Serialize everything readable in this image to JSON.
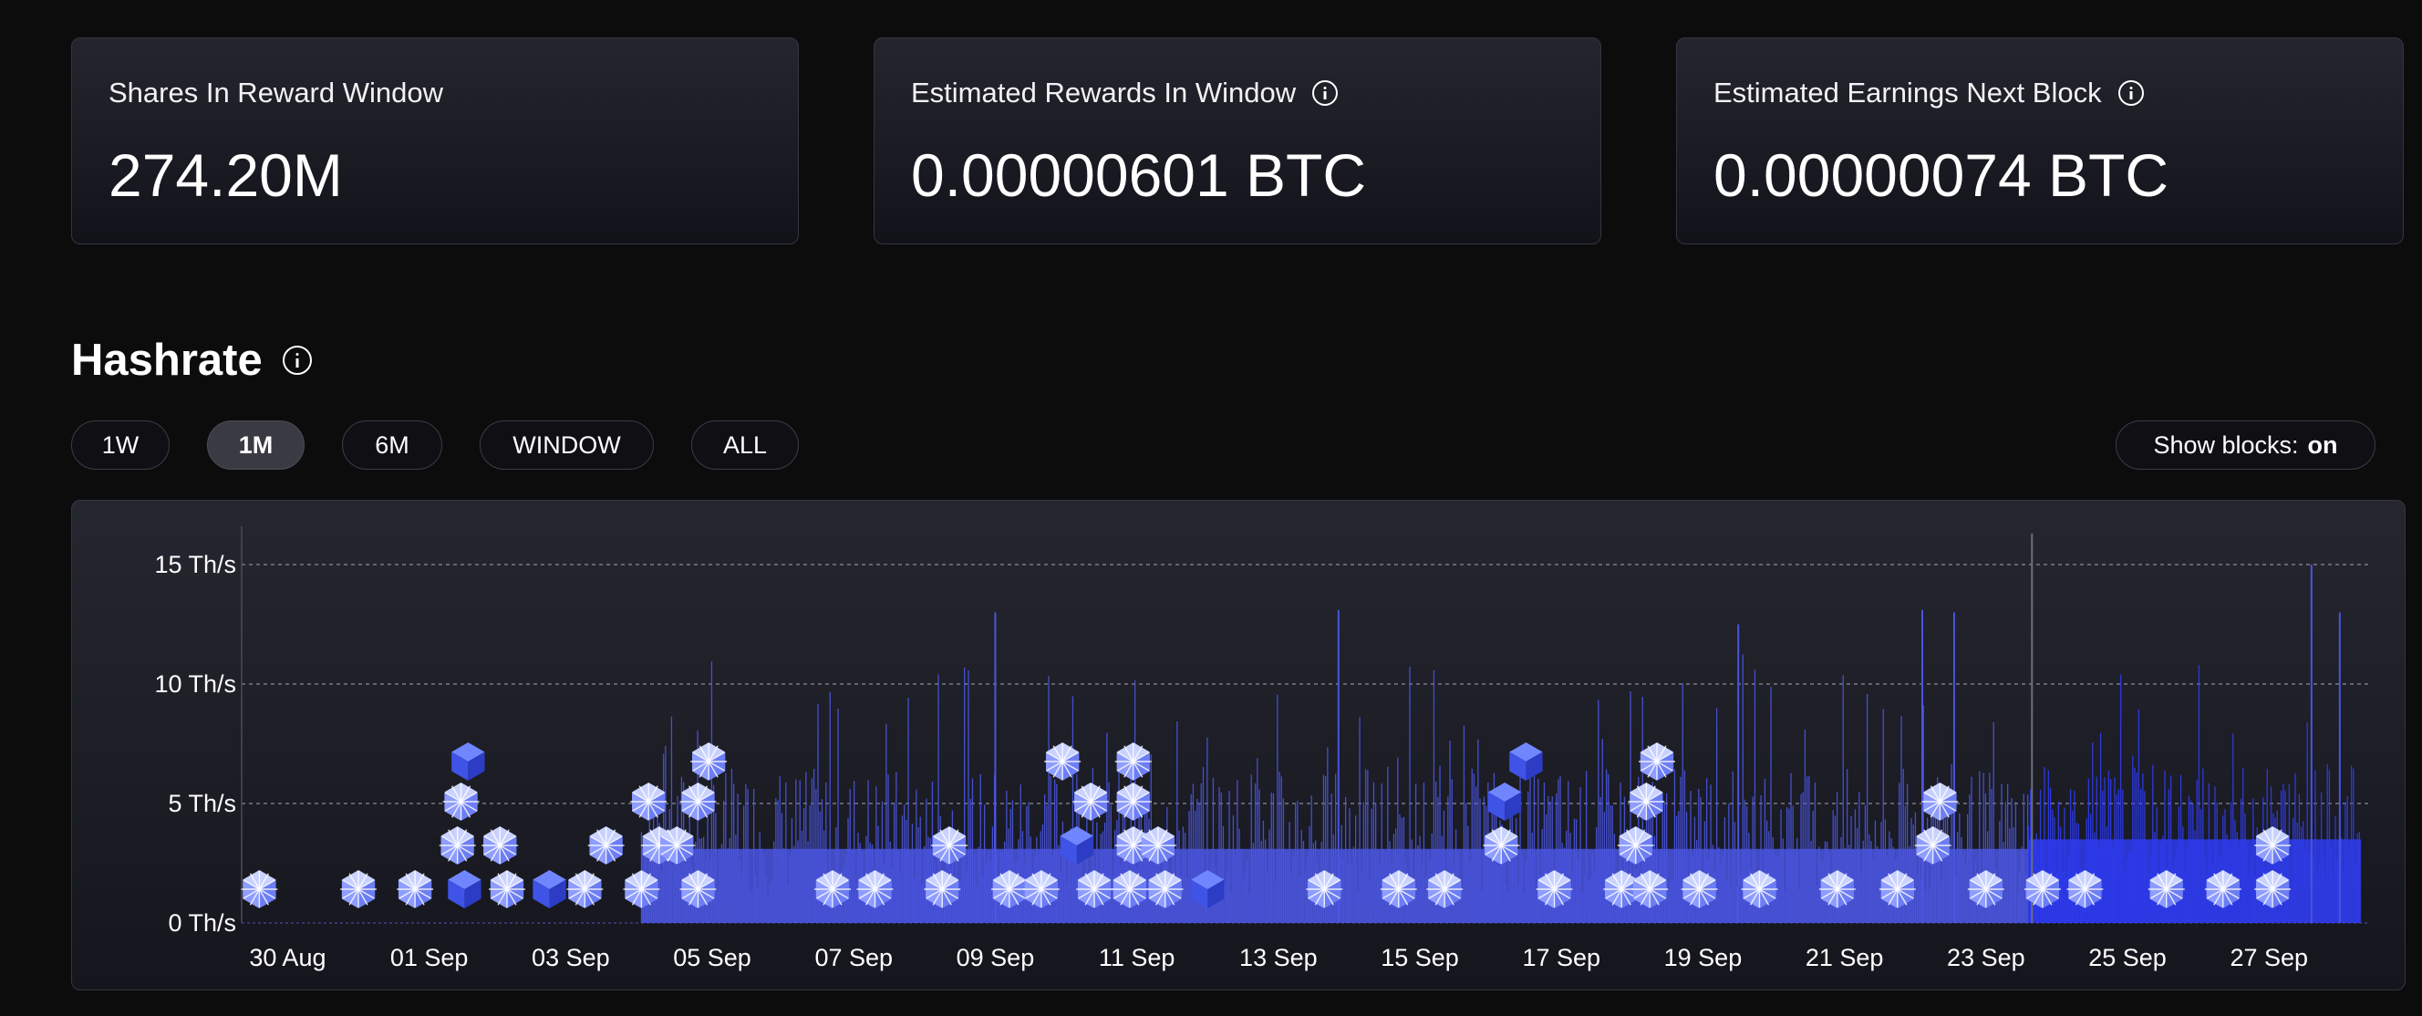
{
  "stats": [
    {
      "label": "Shares In Reward Window",
      "value": "274.20M",
      "has_info": false
    },
    {
      "label": "Estimated Rewards In Window",
      "value": "0.00000601 BTC",
      "has_info": true
    },
    {
      "label": "Estimated Earnings Next Block",
      "value": "0.00000074 BTC",
      "has_info": true
    }
  ],
  "section": {
    "title": "Hashrate"
  },
  "ranges": [
    "1W",
    "1M",
    "6M",
    "WINDOW",
    "ALL"
  ],
  "active_range": "1M",
  "show_blocks": {
    "label": "Show blocks:",
    "state": "on"
  },
  "colors": {
    "bars": "#4a55e0",
    "bars_bright": "#2f3cf0",
    "background": "#0c0c0d",
    "block": "#4a62f0"
  },
  "chart_data": {
    "type": "bar",
    "title": "",
    "xlabel": "",
    "ylabel": "",
    "y_unit": "Th/s",
    "ylim": [
      0,
      16
    ],
    "y_ticks": [
      0,
      5,
      10,
      15
    ],
    "y_tick_labels": [
      "0 Th/s",
      "5 Th/s",
      "10 Th/s",
      "15 Th/s"
    ],
    "x_tick_labels": [
      "30 Aug",
      "01 Sep",
      "03 Sep",
      "05 Sep",
      "07 Sep",
      "09 Sep",
      "11 Sep",
      "13 Sep",
      "15 Sep",
      "17 Sep",
      "19 Sep",
      "21 Sep",
      "23 Sep",
      "25 Sep",
      "27 Sep"
    ],
    "x_range_days": [
      -0.65,
      29.3
    ],
    "grid": true,
    "series": [
      {
        "segments": [
          {
            "start_day": 5.0,
            "end_day": 24.6,
            "base": 3.6,
            "variation": 2.4
          },
          {
            "start_day": 24.6,
            "end_day": 29.3,
            "base": 4.0,
            "variation": 2.2
          }
        ],
        "peaks": [
          {
            "day": 10.0,
            "value": 13.0
          },
          {
            "day": 14.85,
            "value": 13.1
          },
          {
            "day": 20.5,
            "value": 12.5
          },
          {
            "day": 23.1,
            "value": 13.1
          },
          {
            "day": 23.55,
            "value": 13.0
          },
          {
            "day": 24.65,
            "value": 16.3
          },
          {
            "day": 28.6,
            "value": 15.0
          },
          {
            "day": 29.0,
            "value": 13.0
          }
        ]
      }
    ],
    "blocks": [
      {
        "day": -0.4,
        "level": 0
      },
      {
        "day": 1.0,
        "level": 0
      },
      {
        "day": 1.8,
        "level": 0
      },
      {
        "day": 2.5,
        "level": 0,
        "found": true
      },
      {
        "day": 3.1,
        "level": 0
      },
      {
        "day": 3.7,
        "level": 0,
        "found": true
      },
      {
        "day": 4.2,
        "level": 0
      },
      {
        "day": 5.0,
        "level": 0
      },
      {
        "day": 5.8,
        "level": 0
      },
      {
        "day": 7.7,
        "level": 0
      },
      {
        "day": 8.3,
        "level": 0
      },
      {
        "day": 9.25,
        "level": 0
      },
      {
        "day": 10.2,
        "level": 0
      },
      {
        "day": 10.65,
        "level": 0
      },
      {
        "day": 11.4,
        "level": 0
      },
      {
        "day": 11.9,
        "level": 0
      },
      {
        "day": 12.4,
        "level": 0
      },
      {
        "day": 13.0,
        "level": 0,
        "found": true
      },
      {
        "day": 14.65,
        "level": 0
      },
      {
        "day": 15.7,
        "level": 0
      },
      {
        "day": 16.35,
        "level": 0
      },
      {
        "day": 17.9,
        "level": 0
      },
      {
        "day": 18.85,
        "level": 0
      },
      {
        "day": 19.25,
        "level": 0
      },
      {
        "day": 19.95,
        "level": 0
      },
      {
        "day": 20.8,
        "level": 0
      },
      {
        "day": 21.9,
        "level": 0
      },
      {
        "day": 22.75,
        "level": 0
      },
      {
        "day": 24.0,
        "level": 0
      },
      {
        "day": 24.8,
        "level": 0
      },
      {
        "day": 25.4,
        "level": 0
      },
      {
        "day": 26.55,
        "level": 0
      },
      {
        "day": 27.35,
        "level": 0
      },
      {
        "day": 28.05,
        "level": 0
      },
      {
        "day": 2.4,
        "level": 1
      },
      {
        "day": 3.0,
        "level": 1
      },
      {
        "day": 4.5,
        "level": 1
      },
      {
        "day": 5.25,
        "level": 1
      },
      {
        "day": 5.5,
        "level": 1
      },
      {
        "day": 9.35,
        "level": 1
      },
      {
        "day": 11.15,
        "level": 1,
        "found": true
      },
      {
        "day": 11.95,
        "level": 1
      },
      {
        "day": 12.3,
        "level": 1
      },
      {
        "day": 17.15,
        "level": 1
      },
      {
        "day": 19.05,
        "level": 1
      },
      {
        "day": 23.25,
        "level": 1
      },
      {
        "day": 28.05,
        "level": 1
      },
      {
        "day": 2.45,
        "level": 2
      },
      {
        "day": 5.1,
        "level": 2
      },
      {
        "day": 5.8,
        "level": 2
      },
      {
        "day": 11.35,
        "level": 2
      },
      {
        "day": 11.95,
        "level": 2
      },
      {
        "day": 17.2,
        "level": 2,
        "found": true
      },
      {
        "day": 19.2,
        "level": 2
      },
      {
        "day": 23.35,
        "level": 2
      },
      {
        "day": 2.55,
        "level": 3,
        "found": true
      },
      {
        "day": 5.95,
        "level": 3
      },
      {
        "day": 10.95,
        "level": 3
      },
      {
        "day": 11.95,
        "level": 3
      },
      {
        "day": 17.5,
        "level": 3,
        "found": true
      },
      {
        "day": 19.35,
        "level": 3
      }
    ]
  }
}
